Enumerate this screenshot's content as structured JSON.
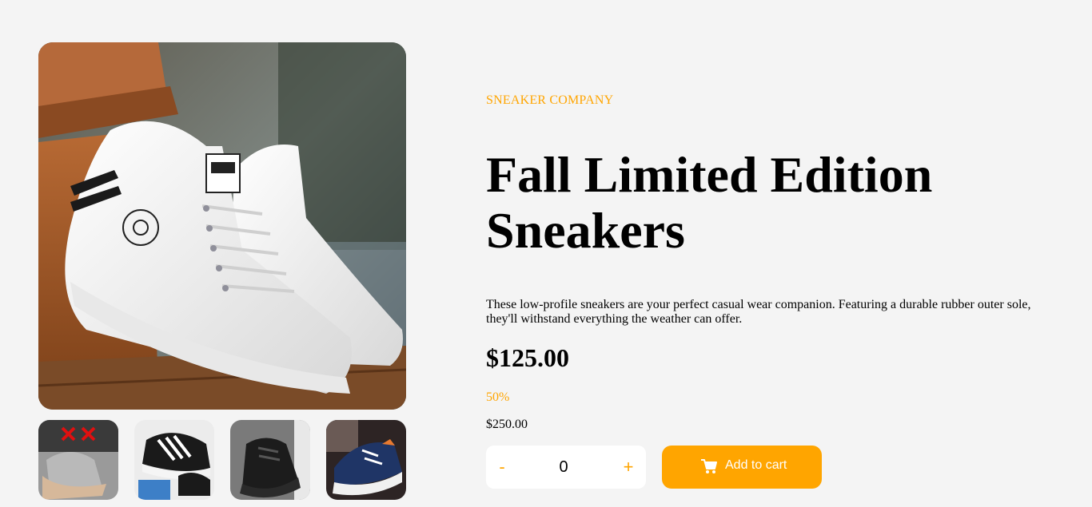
{
  "product": {
    "company": "SNEAKER COMPANY",
    "title": "Fall Limited Edition Sneakers",
    "description": "These low-profile sneakers are your perfect casual wear companion. Featuring a durable rubber outer sole, they'll withstand everything the weather can offer.",
    "price": "$125.00",
    "discount": "50%",
    "old_price": "$250.00"
  },
  "cart": {
    "minus_label": "-",
    "plus_label": "+",
    "quantity": "0",
    "add_label": "Add to cart"
  },
  "gallery": {
    "main_image": "white high-top sneakers",
    "thumbnails": [
      {
        "name": "grey sneaker with red laces"
      },
      {
        "name": "black and white sneaker on box"
      },
      {
        "name": "black chunky sneaker"
      },
      {
        "name": "navy sneaker"
      }
    ]
  },
  "colors": {
    "accent": "#ffa500",
    "background": "#f4f4f4"
  }
}
